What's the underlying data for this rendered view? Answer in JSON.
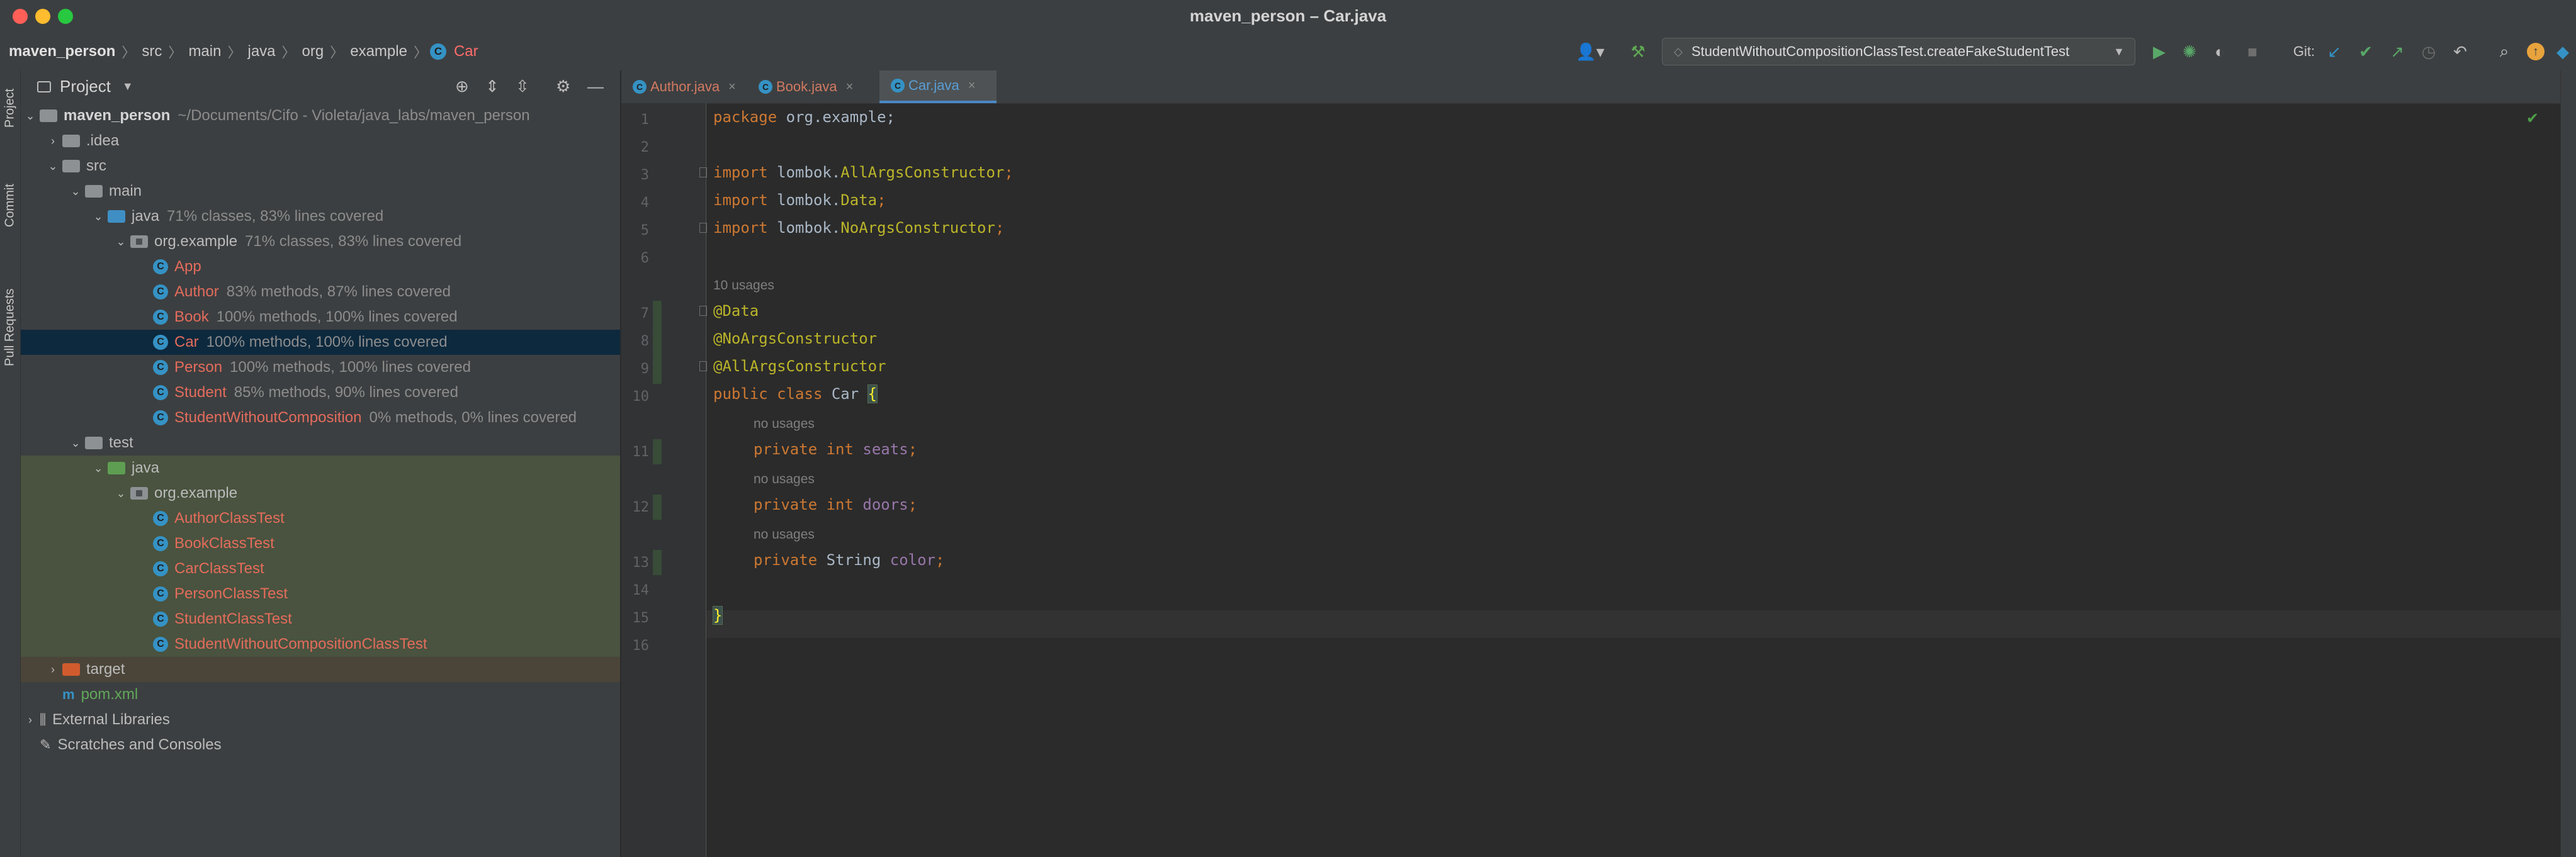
{
  "window": {
    "title": "maven_person – Car.java"
  },
  "breadcrumb": [
    "maven_person",
    "src",
    "main",
    "java",
    "org",
    "example",
    "Car"
  ],
  "toolbar": {
    "run_config": "StudentWithoutCompositionClassTest.createFakeStudentTest",
    "git_label": "Git:"
  },
  "sidebar_tabs": [
    "Project",
    "Commit",
    "Pull Requests"
  ],
  "project_panel": {
    "title": "Project",
    "tree": [
      {
        "label": "maven_person",
        "meta": "~/Documents/Cifo - Violeta/java_labs/maven_person"
      },
      {
        "label": ".idea"
      },
      {
        "label": "src"
      },
      {
        "label": "main"
      },
      {
        "label": "java",
        "meta": "71% classes, 83% lines covered"
      },
      {
        "label": "org.example",
        "meta": "71% classes, 83% lines covered"
      },
      {
        "label": "App"
      },
      {
        "label": "Author",
        "meta": "83% methods, 87% lines covered"
      },
      {
        "label": "Book",
        "meta": "100% methods, 100% lines covered"
      },
      {
        "label": "Car",
        "meta": "100% methods, 100% lines covered"
      },
      {
        "label": "Person",
        "meta": "100% methods, 100% lines covered"
      },
      {
        "label": "Student",
        "meta": "85% methods, 90% lines covered"
      },
      {
        "label": "StudentWithoutComposition",
        "meta": "0% methods, 0% lines covered"
      },
      {
        "label": "test"
      },
      {
        "label": "java"
      },
      {
        "label": "org.example"
      },
      {
        "label": "AuthorClassTest"
      },
      {
        "label": "BookClassTest"
      },
      {
        "label": "CarClassTest"
      },
      {
        "label": "PersonClassTest"
      },
      {
        "label": "StudentClassTest"
      },
      {
        "label": "StudentWithoutCompositionClassTest"
      },
      {
        "label": "target"
      },
      {
        "label": "pom.xml"
      },
      {
        "label": "External Libraries"
      },
      {
        "label": "Scratches and Consoles"
      }
    ]
  },
  "editor": {
    "tabs": [
      "Author.java",
      "Book.java",
      "Car.java"
    ],
    "active_tab": "Car.java",
    "line_numbers": [
      "1",
      "2",
      "3",
      "4",
      "5",
      "6",
      "7",
      "8",
      "9",
      "10",
      "11",
      "12",
      "13",
      "14",
      "15",
      "16"
    ],
    "code": {
      "l1_kw": "package",
      "l1_rest": " org.example;",
      "l3_kw": "import",
      "l3_pkg": " lombok.",
      "l3_ann": "AllArgsConstructor",
      "l3_end": ";",
      "l4_kw": "import",
      "l4_pkg": " lombok.",
      "l4_ann": "Data",
      "l4_end": ";",
      "l5_kw": "import",
      "l5_pkg": " lombok.",
      "l5_ann": "NoArgsConstructor",
      "l5_end": ";",
      "usages_class": "10 usages",
      "l7": "@Data",
      "l8": "@NoArgsConstructor",
      "l9": "@AllArgsConstructor",
      "l10_kw": "public class",
      "l10_name": " Car ",
      "l10_brace": "{",
      "usages_field": "no usages",
      "l11_kw": "private int",
      "l11_field": " seats",
      "l11_end": ";",
      "l12_kw": "private int",
      "l12_field": " doors",
      "l12_end": ";",
      "l13_kw": "private",
      "l13_type": " String",
      "l13_field": " color",
      "l13_end": ";",
      "l15_brace": "}"
    }
  },
  "colors": {
    "keyword": "#cc7832",
    "annotation": "#bbb529",
    "field": "#9876aa",
    "selection": "#0d293e",
    "test_folder_bg": "#49533f"
  }
}
